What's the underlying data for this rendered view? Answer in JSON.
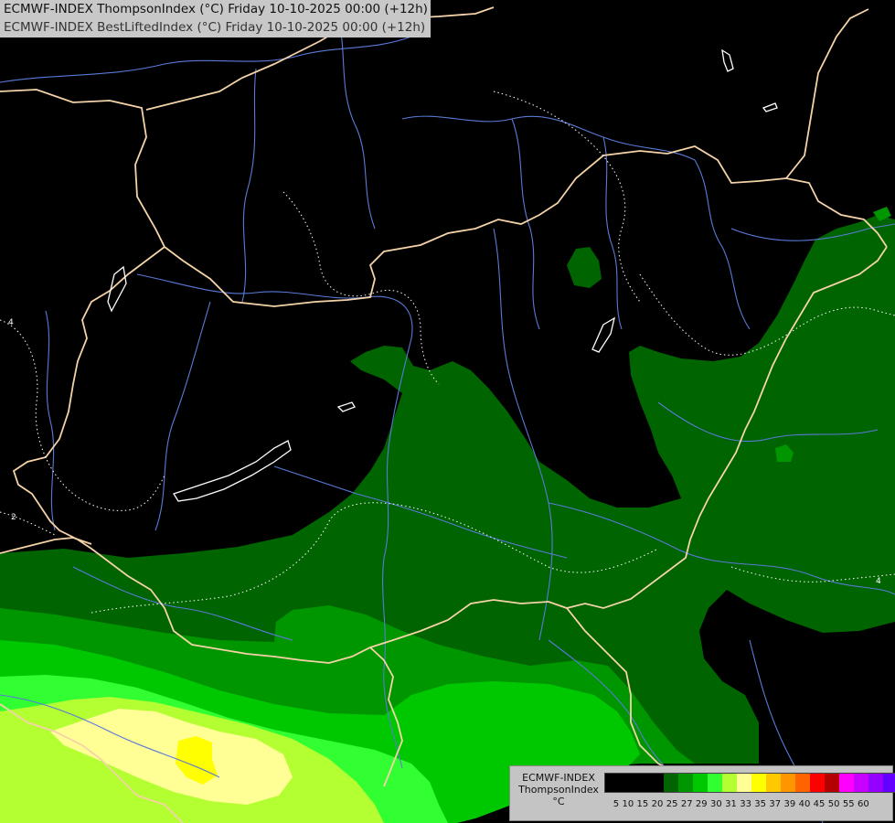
{
  "header": {
    "line1": "ECMWF-INDEX ThompsonIndex (°C) Friday 10-10-2025 00:00 (+12h)",
    "line2": "ECMWF-INDEX BestLiftedIndex (°C) Friday 10-10-2025 00:00 (+12h)"
  },
  "legend": {
    "title": "ECMWF-INDEX",
    "parameter": "ThompsonIndex",
    "unit": "°C",
    "ticks": [
      "5",
      "10",
      "15",
      "20",
      "25",
      "27",
      "29",
      "30",
      "31",
      "33",
      "35",
      "37",
      "39",
      "40",
      "45",
      "50",
      "55",
      "60"
    ],
    "colors": [
      "#000000",
      "#000000",
      "#000000",
      "#000000",
      "#006400",
      "#009600",
      "#00c800",
      "#32ff32",
      "#b4ff32",
      "#ffff96",
      "#ffff00",
      "#ffc800",
      "#ff9600",
      "#ff6400",
      "#ff0000",
      "#b40000",
      "#ff00ff",
      "#c800ff",
      "#9600ff",
      "#6400ff",
      "#0000ff"
    ]
  },
  "map": {
    "contour_labels": [
      "4",
      "4",
      "2"
    ],
    "colors": {
      "background": "#000000",
      "zone_25": "#006400",
      "zone_27": "#009600",
      "zone_29": "#00c800",
      "zone_30": "#32ff32",
      "zone_31": "#b4ff32",
      "zone_33": "#ffff96",
      "zone_35": "#ffff00",
      "border": "#f5d3a8",
      "river": "#5a7ad8",
      "contour": "#ffffff"
    }
  }
}
